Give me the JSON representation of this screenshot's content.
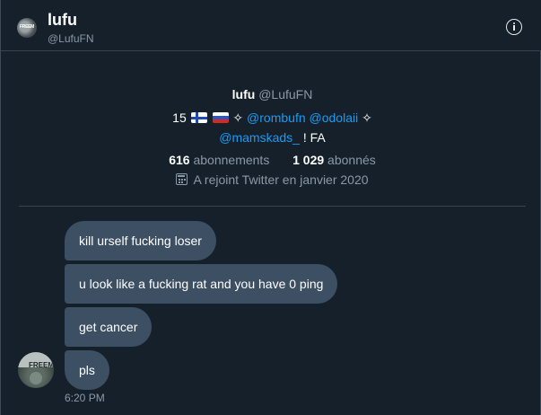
{
  "header": {
    "name": "lufu",
    "handle": "@LufuFN",
    "avatar_text": "FREEM",
    "info_icon": "info-circle-icon"
  },
  "profile": {
    "name": "lufu",
    "handle": "@LufuFN",
    "bio_prefix": "15",
    "bio_sparkle1": "✧",
    "bio_mention1": "@rombufn",
    "bio_mention2": "@odolaii",
    "bio_sparkle2": "✧",
    "bio_mention3": "@mamskads_",
    "bio_suffix": "! FA",
    "following_count": "616",
    "following_label": "abonnements",
    "followers_count": "1 029",
    "followers_label": "abonnés",
    "joined": "A rejoint Twitter en janvier 2020",
    "joined_icon": "calendar-icon"
  },
  "messages": [
    {
      "text": "kill urself fucking loser"
    },
    {
      "text": "u look like a fucking rat and you have 0 ping"
    },
    {
      "text": "get cancer"
    },
    {
      "text": "pls"
    }
  ],
  "message_avatar_text": "FREEM",
  "timestamp": "6:20 PM",
  "colors": {
    "background": "#15202b",
    "bubble": "#3d4f62",
    "mention": "#1d9bf0",
    "muted": "#8b98a5"
  }
}
